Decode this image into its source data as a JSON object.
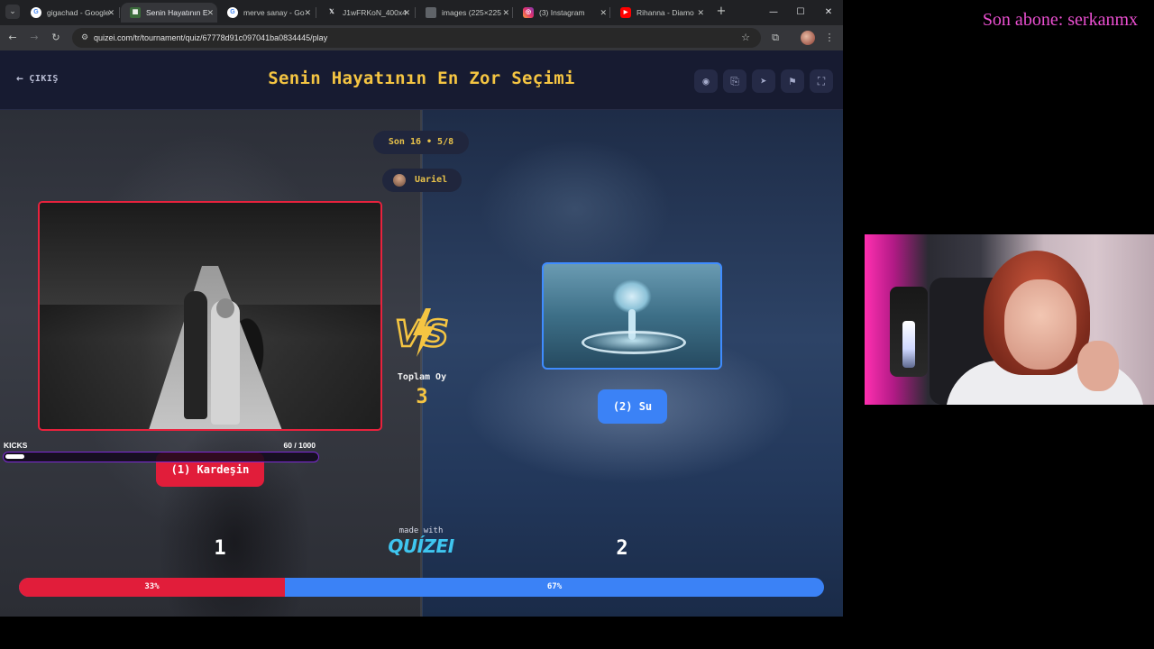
{
  "browser": {
    "tabs": [
      {
        "label": "gigachad - Google",
        "favicon": "G",
        "active": false
      },
      {
        "label": "Senin Hayatının E",
        "favicon": "Q",
        "active": true
      },
      {
        "label": "merve sanay - Go",
        "favicon": "G",
        "active": false
      },
      {
        "label": "J1wFRKoN_400x4",
        "favicon": "X",
        "active": false
      },
      {
        "label": "images (225×225",
        "favicon": "",
        "active": false
      },
      {
        "label": "(3) Instagram",
        "favicon": "◎",
        "active": false
      },
      {
        "label": "Rihanna - Diamo",
        "favicon": "▶",
        "active": false
      }
    ],
    "tab_colors": [
      "#4285f4",
      "#3b6b3b",
      "#4285f4",
      "#000000",
      "#5f6368",
      "#e1306c",
      "#ff0000"
    ],
    "url": "quizei.com/tr/tournament/quiz/67778d91c097041ba0834445/play"
  },
  "header": {
    "exit_label": "ÇIKIŞ",
    "title": "Senin Hayatının En Zor Seçimi",
    "actions": [
      "eye-icon",
      "share-icon",
      "send-icon",
      "flag-icon",
      "fullscreen-icon"
    ]
  },
  "round": {
    "label": "Son 16 • 5/8",
    "user": "Uariel"
  },
  "choices": {
    "left": {
      "label": "(1) Kardeşin",
      "side_number": "1",
      "color": "#e11d3a"
    },
    "right": {
      "label": "(2) Su",
      "side_number": "2",
      "color": "#3b82f6"
    }
  },
  "votes": {
    "total_label": "Toplam Oy",
    "total_value": "3",
    "left_percent": 33,
    "right_percent": 67,
    "left_percent_text": "33%",
    "right_percent_text": "67%"
  },
  "kicks": {
    "label": "KICKS",
    "count_text": "60  / 1000",
    "current": 60,
    "goal": 1000
  },
  "branding": {
    "made_with": "made with",
    "logo": "QUÍZEI"
  },
  "overlay": {
    "subscriber_text": "Son abone: serkanmx"
  },
  "colors": {
    "accent_yellow": "#f5c542",
    "red": "#e11d3a",
    "blue": "#3b82f6",
    "subscriber_pink": "#ea4fd0"
  }
}
